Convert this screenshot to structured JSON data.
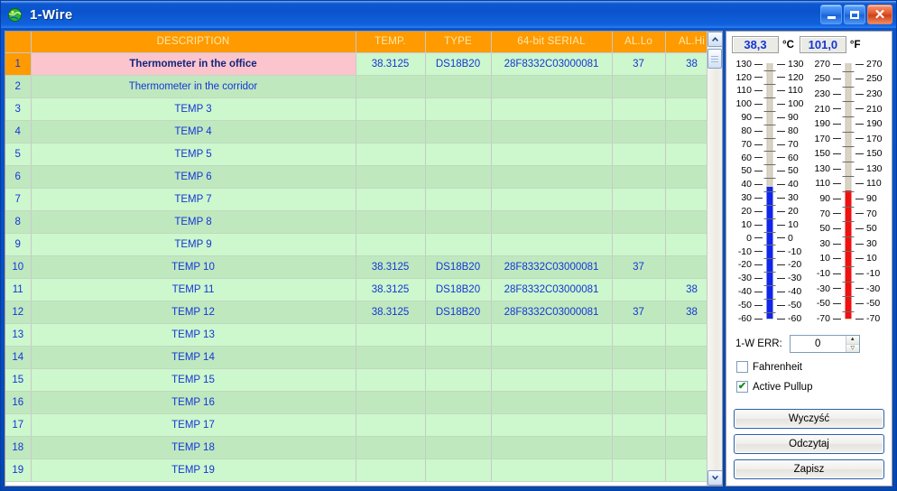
{
  "window": {
    "title": "1-Wire",
    "icon": "globe-icon",
    "minimize_label": "Minimize",
    "maximize_label": "Maximize",
    "close_label": "Close"
  },
  "table": {
    "columns": [
      "",
      "DESCRIPTION",
      "TEMP.",
      "TYPE",
      "64-bit SERIAL",
      "AL.Lo",
      "AL.Hi"
    ],
    "rows": [
      {
        "idx": "1",
        "desc": "Thermometer in the office",
        "temp": "38.3125",
        "type": "DS18B20",
        "serial": "28F8332C03000081",
        "lo": "37",
        "hi": "38",
        "selected": true
      },
      {
        "idx": "2",
        "desc": "Thermometer in the corridor",
        "temp": "",
        "type": "",
        "serial": "",
        "lo": "",
        "hi": ""
      },
      {
        "idx": "3",
        "desc": "TEMP 3",
        "temp": "",
        "type": "",
        "serial": "",
        "lo": "",
        "hi": ""
      },
      {
        "idx": "4",
        "desc": "TEMP 4",
        "temp": "",
        "type": "",
        "serial": "",
        "lo": "",
        "hi": ""
      },
      {
        "idx": "5",
        "desc": "TEMP 5",
        "temp": "",
        "type": "",
        "serial": "",
        "lo": "",
        "hi": ""
      },
      {
        "idx": "6",
        "desc": "TEMP 6",
        "temp": "",
        "type": "",
        "serial": "",
        "lo": "",
        "hi": ""
      },
      {
        "idx": "7",
        "desc": "TEMP 7",
        "temp": "",
        "type": "",
        "serial": "",
        "lo": "",
        "hi": ""
      },
      {
        "idx": "8",
        "desc": "TEMP 8",
        "temp": "",
        "type": "",
        "serial": "",
        "lo": "",
        "hi": ""
      },
      {
        "idx": "9",
        "desc": "TEMP 9",
        "temp": "",
        "type": "",
        "serial": "",
        "lo": "",
        "hi": ""
      },
      {
        "idx": "10",
        "desc": "TEMP 10",
        "temp": "38.3125",
        "type": "DS18B20",
        "serial": "28F8332C03000081",
        "lo": "37",
        "hi": ""
      },
      {
        "idx": "11",
        "desc": "TEMP 11",
        "temp": "38.3125",
        "type": "DS18B20",
        "serial": "28F8332C03000081",
        "lo": "",
        "hi": "38"
      },
      {
        "idx": "12",
        "desc": "TEMP 12",
        "temp": "38.3125",
        "type": "DS18B20",
        "serial": "28F8332C03000081",
        "lo": "37",
        "hi": "38"
      },
      {
        "idx": "13",
        "desc": "TEMP 13",
        "temp": "",
        "type": "",
        "serial": "",
        "lo": "",
        "hi": ""
      },
      {
        "idx": "14",
        "desc": "TEMP 14",
        "temp": "",
        "type": "",
        "serial": "",
        "lo": "",
        "hi": ""
      },
      {
        "idx": "15",
        "desc": "TEMP 15",
        "temp": "",
        "type": "",
        "serial": "",
        "lo": "",
        "hi": ""
      },
      {
        "idx": "16",
        "desc": "TEMP 16",
        "temp": "",
        "type": "",
        "serial": "",
        "lo": "",
        "hi": ""
      },
      {
        "idx": "17",
        "desc": "TEMP 17",
        "temp": "",
        "type": "",
        "serial": "",
        "lo": "",
        "hi": ""
      },
      {
        "idx": "18",
        "desc": "TEMP 18",
        "temp": "",
        "type": "",
        "serial": "",
        "lo": "",
        "hi": ""
      },
      {
        "idx": "19",
        "desc": "TEMP 19",
        "temp": "",
        "type": "",
        "serial": "",
        "lo": "",
        "hi": ""
      }
    ],
    "scrollbar": {
      "up_icon": "chevron-up-icon",
      "down_icon": "chevron-down-icon"
    }
  },
  "panel": {
    "celsius": {
      "value": "38,3",
      "unit": "°C",
      "numeric": 38.3
    },
    "fahrenheit": {
      "value": "101,0",
      "unit": "°F",
      "numeric": 101.0
    },
    "thermometer_celsius": {
      "ticks": [
        130,
        120,
        110,
        100,
        90,
        80,
        70,
        60,
        50,
        40,
        30,
        20,
        10,
        0,
        -10,
        -20,
        -30,
        -40,
        -50,
        -60
      ],
      "min": -60,
      "max": 130,
      "fill_color": "#1026e8",
      "level": 38.3
    },
    "thermometer_fahrenheit": {
      "ticks": [
        270,
        250,
        230,
        210,
        190,
        170,
        150,
        130,
        110,
        90,
        70,
        50,
        30,
        10,
        -10,
        -30,
        -50,
        -70
      ],
      "min": -70,
      "max": 270,
      "fill_color": "#ef1010",
      "level": 101.0
    },
    "error": {
      "label": "1-W ERR:",
      "value": "0",
      "up_icon": "spinner-up-icon",
      "down_icon": "spinner-down-icon"
    },
    "checkboxes": [
      {
        "label": "Fahrenheit",
        "checked": false
      },
      {
        "label": "Active Pullup",
        "checked": true
      }
    ],
    "buttons": [
      {
        "label": "Wyczyść"
      },
      {
        "label": "Odczytaj"
      },
      {
        "label": "Zapisz"
      }
    ]
  }
}
